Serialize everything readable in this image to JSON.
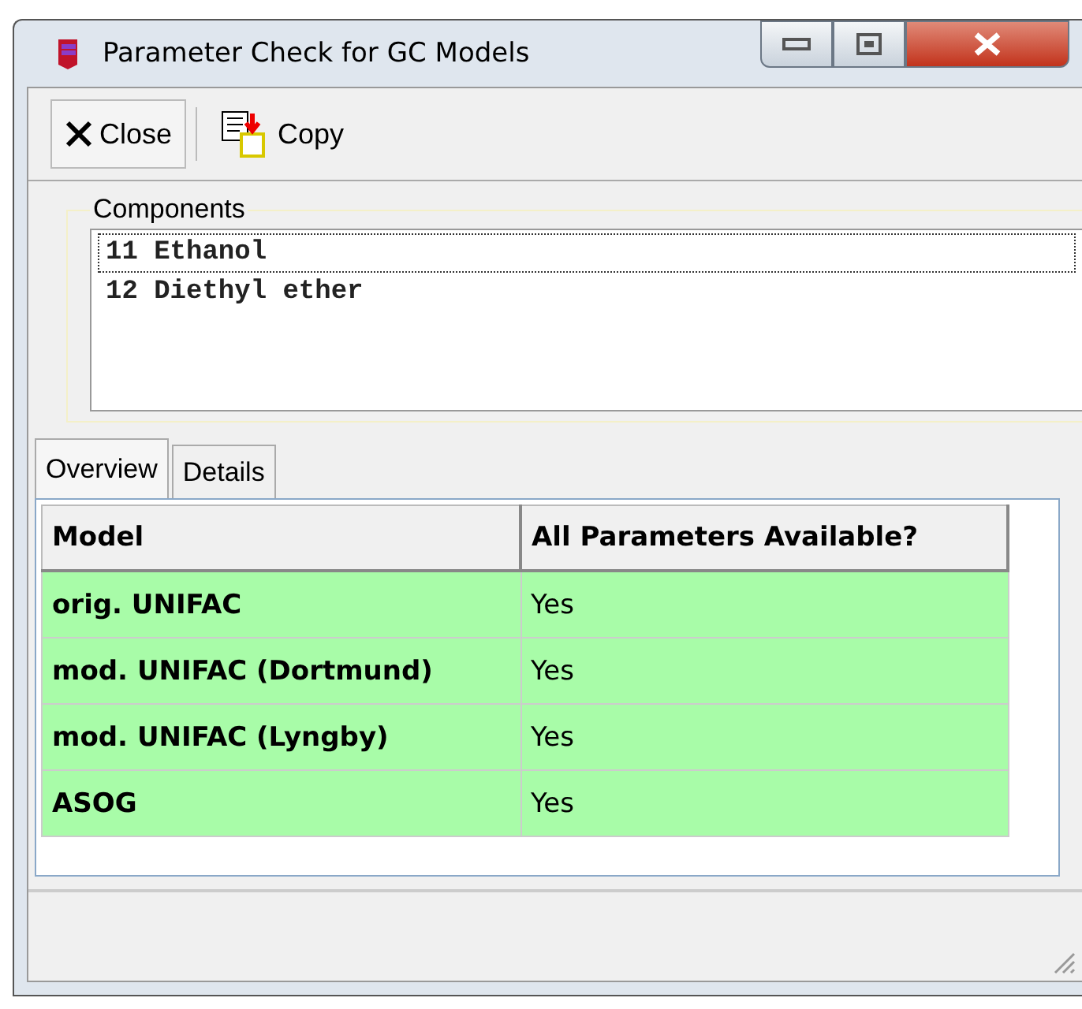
{
  "window": {
    "title": "Parameter Check for GC Models"
  },
  "toolbar": [
    {
      "label": "Close",
      "kind": "close"
    },
    {
      "label": "Copy",
      "kind": "copy"
    }
  ],
  "components": {
    "title": "Components",
    "items": [
      {
        "label": "11 Ethanol",
        "selected": true
      },
      {
        "label": "12 Diethyl ether",
        "selected": false
      }
    ]
  },
  "tabs": [
    {
      "label": "Overview",
      "selected": true
    },
    {
      "label": "Details",
      "selected": false
    }
  ],
  "table": {
    "columns": [
      "Model",
      "All Parameters Available?"
    ],
    "rows": [
      {
        "model": "orig. UNIFAC",
        "available": "Yes",
        "color": "#a8fca8"
      },
      {
        "model": "mod. UNIFAC (Dortmund)",
        "available": "Yes",
        "color": "#a8fca8"
      },
      {
        "model": "mod. UNIFAC (Lyngby)",
        "available": "Yes",
        "color": "#a8fca8"
      },
      {
        "model": "ASOG",
        "available": "Yes",
        "color": "#a8fca8"
      }
    ]
  }
}
